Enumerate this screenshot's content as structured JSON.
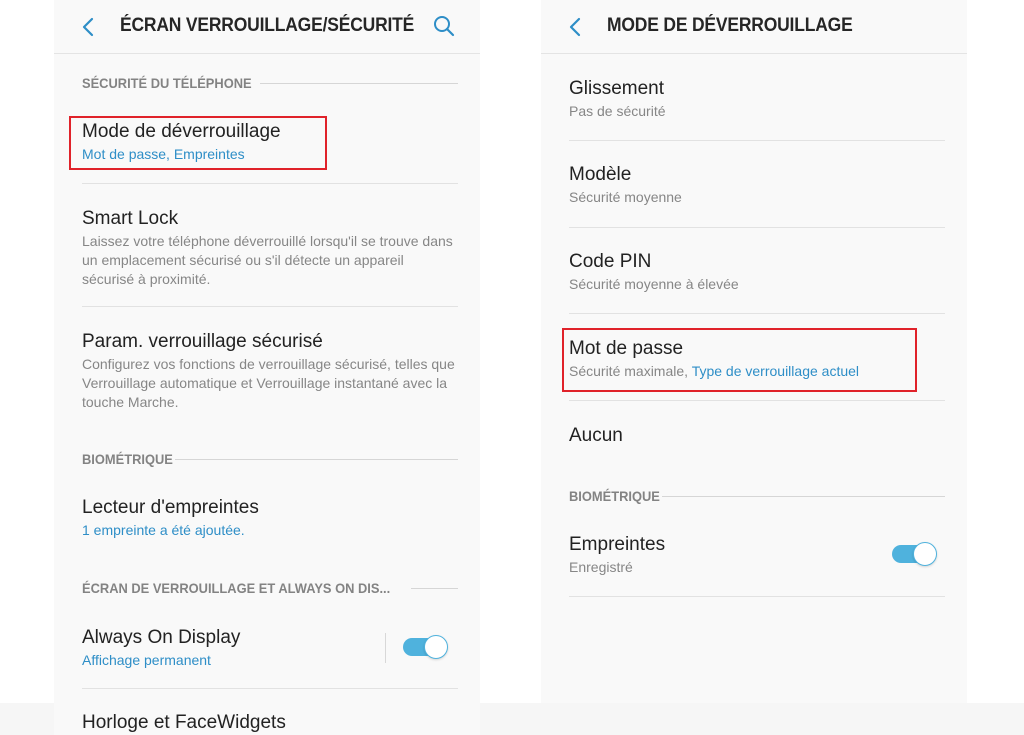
{
  "left_screen": {
    "title": "ÉCRAN VERROUILLAGE/SÉCURITÉ",
    "sections": {
      "phone_security": "SÉCURITÉ DU TÉLÉPHONE",
      "biometric": "BIOMÉTRIQUE",
      "lock_aod": "ÉCRAN DE VERROUILLAGE ET ALWAYS ON DIS..."
    },
    "items": {
      "unlock_mode": {
        "title": "Mode de déverrouillage",
        "subtitle": "Mot de passe, Empreintes"
      },
      "smart_lock": {
        "title": "Smart Lock",
        "subtitle": "Laissez votre téléphone déverrouillé lorsqu'il se trouve dans un emplacement sécurisé ou s'il détecte un appareil sécurisé à proximité."
      },
      "secure_lock": {
        "title": "Param. verrouillage sécurisé",
        "subtitle": "Configurez vos fonctions de verrouillage sécurisé, telles que Verrouillage automatique et Verrouillage instantané avec la touche Marche."
      },
      "fingerprint_reader": {
        "title": "Lecteur d'empreintes",
        "subtitle": "1 empreinte a été ajoutée."
      },
      "always_on": {
        "title": "Always On Display",
        "subtitle": "Affichage permanent",
        "enabled": true
      },
      "clock_facewidgets": {
        "title": "Horloge et FaceWidgets"
      }
    }
  },
  "right_screen": {
    "title": "MODE DE DÉVERROUILLAGE",
    "section_biometric": "BIOMÉTRIQUE",
    "items": {
      "swipe": {
        "title": "Glissement",
        "subtitle": "Pas de sécurité"
      },
      "pattern": {
        "title": "Modèle",
        "subtitle": "Sécurité moyenne"
      },
      "pin": {
        "title": "Code PIN",
        "subtitle": "Sécurité moyenne à élevée"
      },
      "password": {
        "title": "Mot de passe",
        "subtitle": "Sécurité maximale, ",
        "subtitle_current": "Type de verrouillage actuel"
      },
      "none": {
        "title": "Aucun"
      },
      "fingerprints": {
        "title": "Empreintes",
        "subtitle": "Enregistré",
        "enabled": true
      }
    }
  },
  "icons": [
    "back-arrow-icon",
    "search-icon"
  ],
  "colors": {
    "accent": "#2e8ec7",
    "toggle": "#4fb2dd",
    "highlight": "#e0222a"
  }
}
